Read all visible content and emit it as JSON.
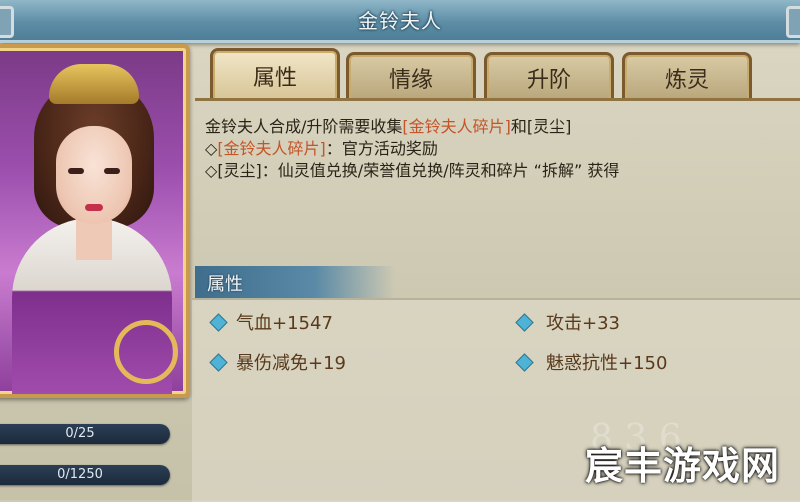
{
  "window": {
    "title": "金铃夫人"
  },
  "tabs": [
    {
      "label": "属性",
      "active": true
    },
    {
      "label": "情缘",
      "active": false
    },
    {
      "label": "升阶",
      "active": false
    },
    {
      "label": "炼灵",
      "active": false
    }
  ],
  "info": {
    "line1_prefix": "金铃夫人合成/升阶需要收集",
    "line1_item1": "[金铃夫人碎片]",
    "line1_mid": "和",
    "line1_item2": "[灵尘]",
    "line2_bullet": "◇",
    "line2_item": "[金铃夫人碎片]",
    "line2_text": "：官方活动奖励",
    "line3_bullet": "◇",
    "line3_text": "[灵尘]：仙灵值兑换/荣誉值兑换/阵灵和碎片 “拆解” 获得"
  },
  "attributes": {
    "header": "属性",
    "items": [
      {
        "label": "气血+1547"
      },
      {
        "label": "攻击+33"
      },
      {
        "label": "暴伤减免+19"
      },
      {
        "label": "魅惑抗性+150"
      }
    ]
  },
  "progress": [
    {
      "text": "0/25",
      "value": 0,
      "max": 25
    },
    {
      "text": "0/1250",
      "value": 0,
      "max": 1250
    }
  ],
  "watermark": {
    "text": "宸丰游戏网",
    "faint_text": "8 3 6"
  },
  "colors": {
    "highlight": "#c4542a",
    "attr_text": "#5a3a1c",
    "header_blue": "#3f6d8c",
    "diamond": "#4fb3d6"
  }
}
